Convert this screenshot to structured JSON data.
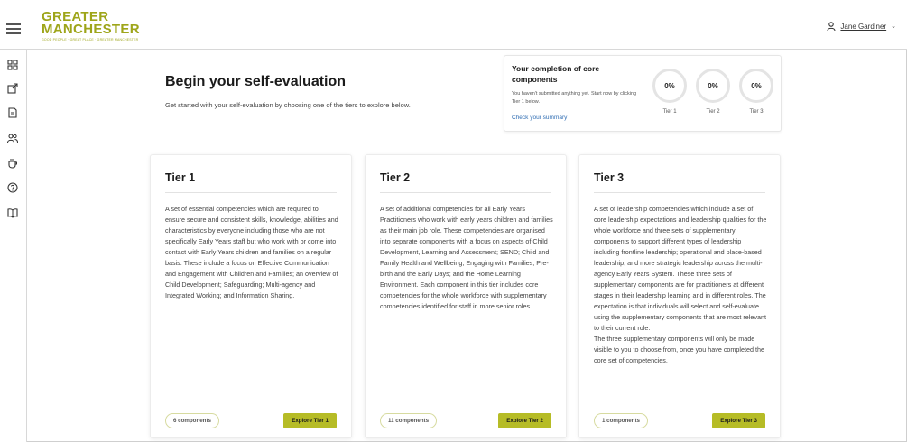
{
  "header": {
    "logo_line1": "GREATER",
    "logo_line2": "MANCHESTER",
    "logo_tagline": "GOOD PEOPLE · GREAT PLACE · GREATER MANCHESTER",
    "user_name": "Jane Gardiner"
  },
  "sidebar": {
    "icons": [
      "grid-icon",
      "external-link-icon",
      "document-icon",
      "people-icon",
      "cup-icon",
      "help-icon",
      "book-icon"
    ]
  },
  "intro": {
    "title": "Begin your self-evaluation",
    "subtitle": "Get started with your self-evaluation by choosing one of the tiers to explore below."
  },
  "completion": {
    "title": "Your completion of core components",
    "text": "You haven't submitted anything yet. Start now by clicking Tier 1 below.",
    "link": "Check your summary",
    "tiers": [
      {
        "value": "0%",
        "label": "Tier 1"
      },
      {
        "value": "0%",
        "label": "Tier 2"
      },
      {
        "value": "0%",
        "label": "Tier 3"
      }
    ]
  },
  "tiers": [
    {
      "title": "Tier 1",
      "description": "A set of essential competencies which are required to ensure secure and consistent skills, knowledge, abilities and characteristics by everyone including those who are not specifically Early Years staff but who work with or come into contact with Early Years children and families on a regular basis. These include a focus on Effective Communication and Engagement with Children and Families; an overview of Child Development; Safeguarding; Multi-agency and Integrated Working; and Information Sharing.",
      "components": "6 components",
      "button": "Explore Tier 1"
    },
    {
      "title": "Tier 2",
      "description": "A set of additional competencies for all Early Years Practitioners who work with early years children and families as their main job role. These competencies are organised into separate components with a focus on aspects of Child Development, Learning and Assessment; SEND; Child and Family Health and Wellbeing; Engaging with Families; Pre-birth and the Early Days; and the Home Learning Environment. Each component in this tier includes core competencies for the whole workforce with supplementary competencies identified for staff in more senior roles.",
      "components": "11 components",
      "button": "Explore Tier 2"
    },
    {
      "title": "Tier 3",
      "description": "A set of leadership competencies which include a set of core leadership expectations and leadership qualities for the whole workforce and three sets of supplementary components to support different types of leadership including frontline leadership; operational and place-based leadership; and more strategic leadership across the multi-agency Early Years System. These three sets of supplementary components are for practitioners at different stages in their leadership learning and in different roles. The expectation is that individuals will select and self-evaluate using the supplementary components that are most relevant to their current role.\nThe three supplementary components will only be made visible to you to choose from, once you have completed the core set of competencies.",
      "components": "1 components",
      "button": "Explore Tier 3"
    }
  ],
  "colors": {
    "accent": "#b6bc26",
    "logo": "#9ea51a",
    "link": "#2f6db3"
  }
}
